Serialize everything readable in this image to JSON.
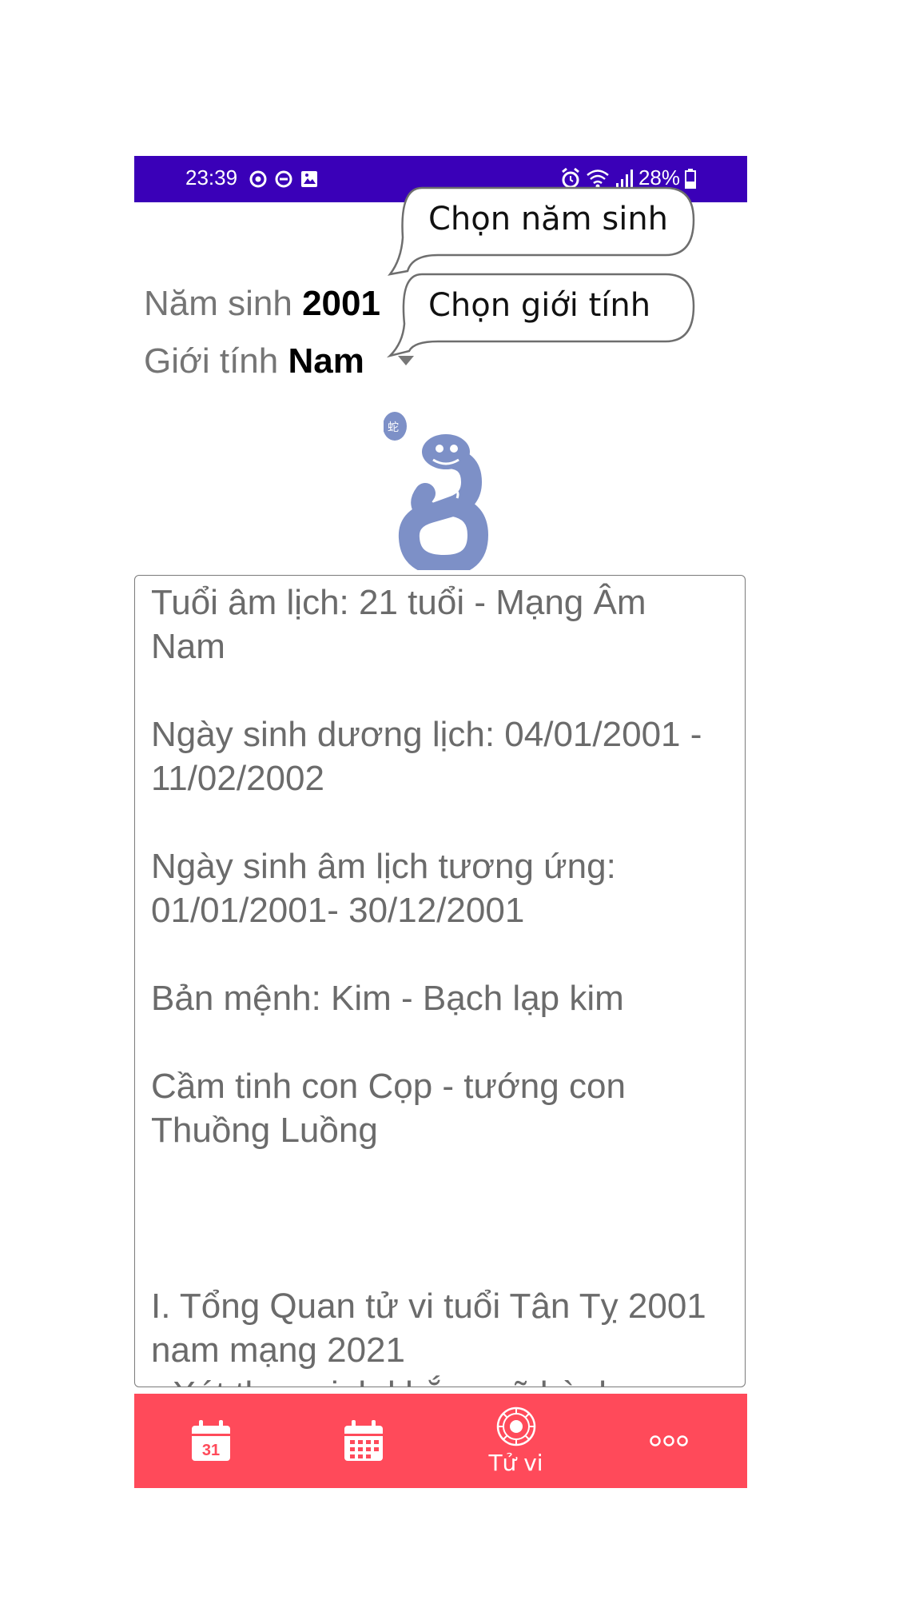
{
  "status_bar": {
    "time": "23:39",
    "battery": "28%",
    "left_icons": [
      "shield-check-icon",
      "dnd-icon",
      "gallery-icon"
    ],
    "right_icons": [
      "alarm-icon",
      "wifi-icon",
      "signal-icon",
      "battery-icon"
    ]
  },
  "form": {
    "year_label": "Năm sinh",
    "year_value": "2001",
    "gender_label": "Giới tính",
    "gender_value": "Nam"
  },
  "tooltips": {
    "year": "Chọn năm sinh",
    "gender": "Chọn giới tính"
  },
  "zodiac": {
    "icon": "snake-icon",
    "color": "#7d90c7"
  },
  "content": {
    "lines": [
      "Tuổi âm lịch: 21 tuổi - Mạng Âm Nam",
      "Ngày sinh dương lịch: 04/01/2001 - 11/02/2002",
      "Ngày sinh âm lịch tương ứng: 01/01/2001- 30/12/2001",
      "Bản mệnh: Kim - Bạch lạp kim",
      "Cầm tinh con Cọp - tướng con Thuồng Luồng",
      "I. Tổng Quan tử vi tuổi Tân Tỵ 2001 nam mạng 2021",
      "- Xét theo sinh khắc ngũ hành:"
    ]
  },
  "bottom_nav": {
    "items": [
      {
        "icon": "calendar-day-icon",
        "badge": "31",
        "label": ""
      },
      {
        "icon": "calendar-month-icon",
        "label": ""
      },
      {
        "icon": "horoscope-wheel-icon",
        "label": "Tử vi"
      },
      {
        "icon": "more-icon",
        "label": ""
      }
    ]
  },
  "colors": {
    "status_bar": "#3a00b8",
    "nav_bar": "#ff4a5a",
    "text_gray": "#6b6b6b"
  }
}
